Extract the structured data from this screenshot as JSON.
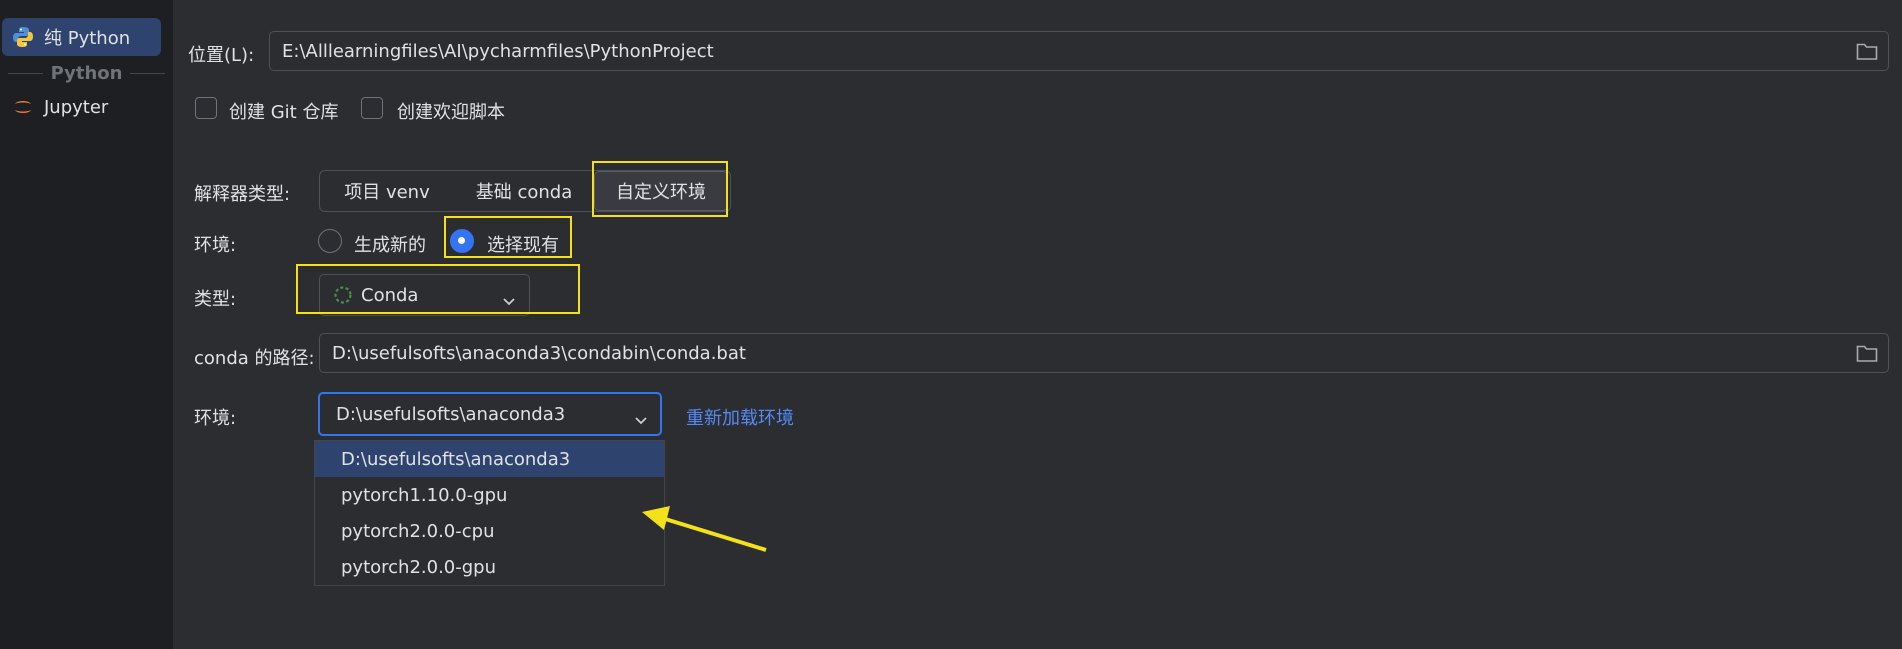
{
  "sidebar": {
    "items": [
      {
        "label": "纯 Python",
        "icon": "python-icon",
        "selected": true
      },
      {
        "label": "Jupyter",
        "icon": "jupyter-icon",
        "selected": false
      }
    ],
    "group_label": "Python"
  },
  "location": {
    "label": "位置(L):",
    "value": "E:\\Alllearningfiles\\AI\\pycharmfiles\\PythonProject"
  },
  "checkboxes": {
    "git": "创建 Git 仓库",
    "welcome": "创建欢迎脚本"
  },
  "interpreter_type": {
    "label": "解释器类型:",
    "options": [
      "项目 venv",
      "基础 conda",
      "自定义环境"
    ],
    "selected": "自定义环境"
  },
  "environment_mode": {
    "label": "环境:",
    "options": [
      "生成新的",
      "选择现有"
    ],
    "selected": "选择现有"
  },
  "type": {
    "label": "类型:",
    "value": "Conda"
  },
  "conda_path": {
    "label": "conda 的路径:",
    "value": "D:\\usefulsofts\\anaconda3\\condabin\\conda.bat"
  },
  "environment": {
    "label": "环境:",
    "value": "D:\\usefulsofts\\anaconda3",
    "reload_link": "重新加载环境",
    "options": [
      "D:\\usefulsofts\\anaconda3",
      "pytorch1.10.0-gpu",
      "pytorch2.0.0-cpu",
      "pytorch2.0.0-gpu"
    ]
  },
  "colors": {
    "accent": "#3574f0",
    "highlight": "#f5e11a",
    "link": "#548af7"
  }
}
